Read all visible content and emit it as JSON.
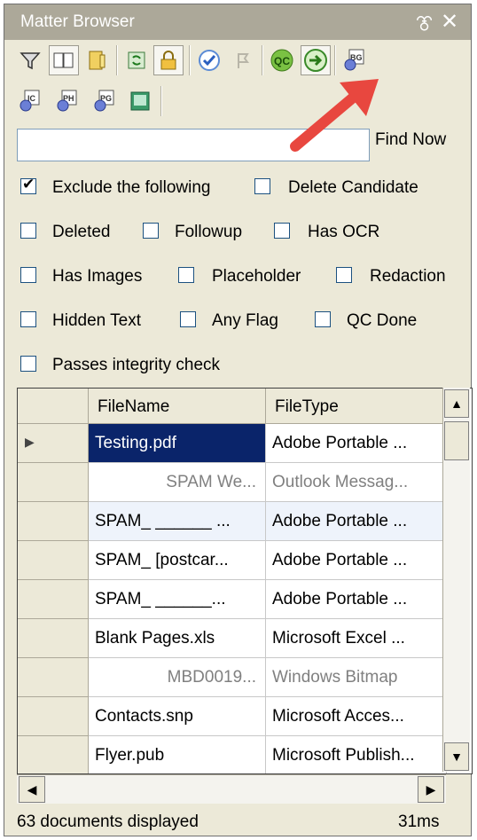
{
  "window": {
    "title": "Matter Browser",
    "pin_glyph": "⯔",
    "close_glyph": "✕"
  },
  "toolbar": {
    "icons": [
      "filter-icon",
      "book-icon",
      "info-book-icon",
      "refresh-icon",
      "lock-icon",
      "check-circle-icon",
      "flag-icon",
      "qc-icon",
      "go-arrow-icon",
      "gear-bg-icon",
      "gear-ic-icon",
      "gear-ph-icon",
      "gear-pg-icon",
      "green-doc-icon"
    ],
    "qc_label": "QC",
    "bg_label": "BG",
    "ic_label": "IC",
    "ph_label": "PH",
    "pg_label": "PG"
  },
  "search": {
    "value": "",
    "find_label": "Find Now"
  },
  "filters": {
    "exclude": {
      "label": "Exclude the following",
      "checked": true
    },
    "delete_candidate": {
      "label": "Delete Candidate",
      "checked": false
    },
    "deleted": {
      "label": "Deleted",
      "checked": false
    },
    "followup": {
      "label": "Followup",
      "checked": false
    },
    "has_ocr": {
      "label": "Has OCR",
      "checked": false
    },
    "has_images": {
      "label": "Has Images",
      "checked": false
    },
    "placeholder": {
      "label": "Placeholder",
      "checked": false
    },
    "redaction": {
      "label": "Redaction",
      "checked": false
    },
    "hidden_text": {
      "label": "Hidden Text",
      "checked": false
    },
    "any_flag": {
      "label": "Any Flag",
      "checked": false
    },
    "qc_done": {
      "label": "QC Done",
      "checked": false
    },
    "integrity": {
      "label": "Passes integrity check",
      "checked": false
    }
  },
  "grid": {
    "columns": [
      "FileName",
      "FileType"
    ],
    "rows": [
      {
        "name": "Testing.pdf",
        "type": "Adobe Portable ...",
        "selected": true,
        "gray": false
      },
      {
        "name": "SPAM  We...",
        "type": "Outlook Messag...",
        "selected": false,
        "gray": true
      },
      {
        "name": "SPAM_ ______ ...",
        "type": "Adobe Portable ...",
        "selected": false,
        "gray": false
      },
      {
        "name": "SPAM_ [postcar...",
        "type": "Adobe Portable ...",
        "selected": false,
        "gray": false
      },
      {
        "name": "SPAM_ ______...",
        "type": "Adobe Portable ...",
        "selected": false,
        "gray": false
      },
      {
        "name": "Blank Pages.xls",
        "type": "Microsoft Excel ...",
        "selected": false,
        "gray": false
      },
      {
        "name": "MBD0019...",
        "type": "Windows Bitmap",
        "selected": false,
        "gray": true
      },
      {
        "name": "Contacts.snp",
        "type": "Microsoft Acces...",
        "selected": false,
        "gray": false
      },
      {
        "name": "Flyer.pub",
        "type": "Microsoft Publish...",
        "selected": false,
        "gray": false
      }
    ]
  },
  "status": {
    "count_text": "63 documents displayed",
    "time_text": "31ms"
  },
  "colors": {
    "accent_arrow": "#e8473f",
    "selection": "#0a246a"
  }
}
